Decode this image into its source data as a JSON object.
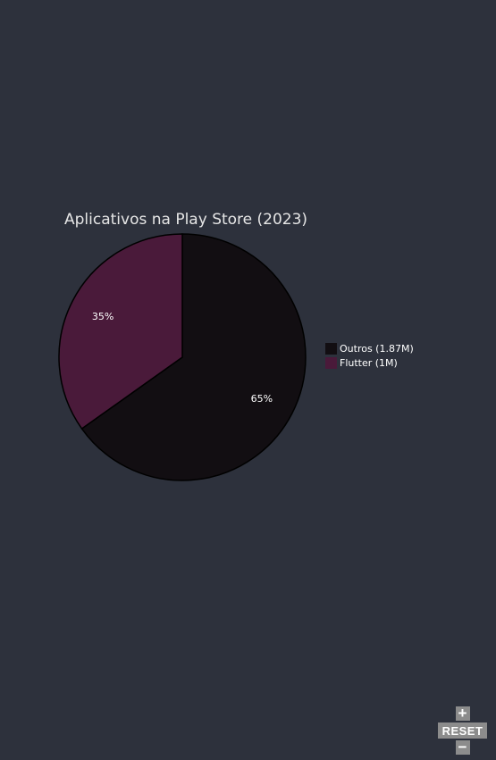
{
  "chart_data": {
    "type": "pie",
    "title": "Aplicativos na Play Store (2023)",
    "slices": [
      {
        "label": "Outros (1.87M)",
        "value": 1.87,
        "percent_label": "65%",
        "color": "#120e12"
      },
      {
        "label": "Flutter (1M)",
        "value": 1.0,
        "percent_label": "35%",
        "color": "#4a1a3a"
      }
    ],
    "legend_position": "right"
  },
  "controls": {
    "zoom_in_symbol": "+",
    "reset_label": "RESET",
    "zoom_out_symbol": "−"
  },
  "colors": {
    "background": "#2d313c",
    "slice_stroke": "#000000",
    "control_button": "#8c8c8c"
  }
}
